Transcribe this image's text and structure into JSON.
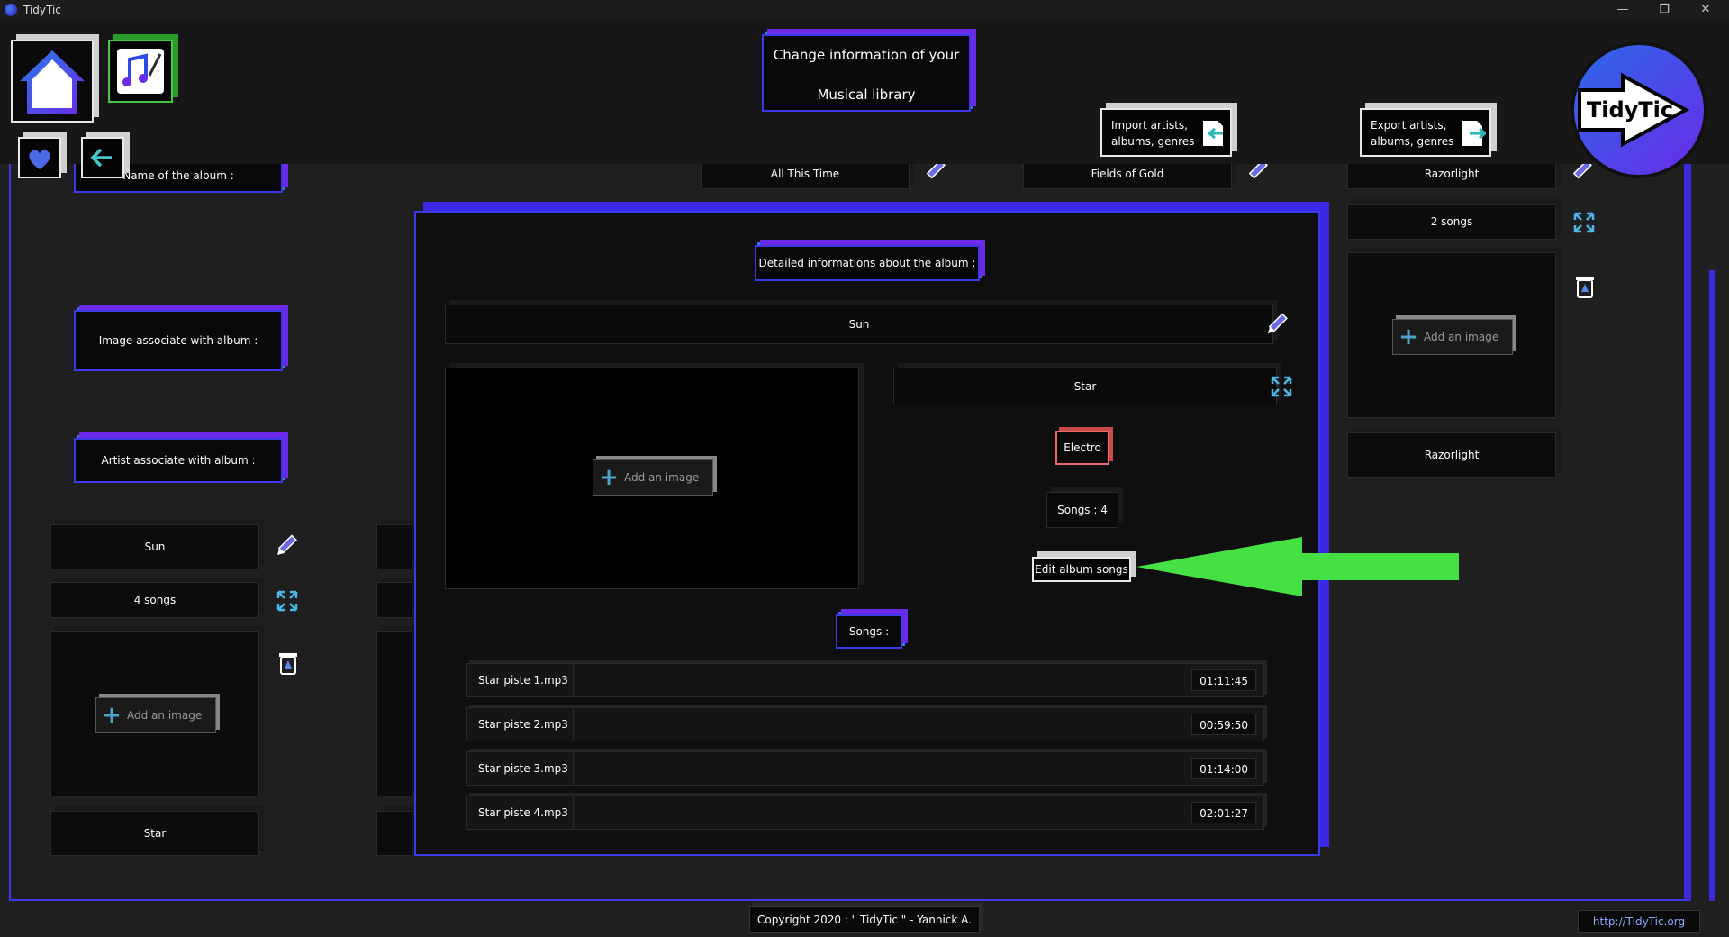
{
  "window": {
    "title": "TidyTic",
    "minimize": "—",
    "restore": "❐",
    "close": "✕"
  },
  "header": {
    "title_line1": "Change information of your",
    "title_line2": "Musical library",
    "import_line1": "Import artists,",
    "import_line2": "albums, genres",
    "export_line1": "Export artists,",
    "export_line2": "albums, genres",
    "logo_text": "TidyTic"
  },
  "left_form": {
    "album_name_label": "Name of the album :",
    "image_label": "Image associate with album :",
    "artist_label": "Artist associate with album :",
    "album_value": "Sun",
    "songs_count": "4 songs",
    "add_image": "Add an image",
    "artist_value": "Star"
  },
  "background_list": {
    "album1": "All This Time",
    "album2": "Fields of Gold",
    "album3": "Razorlight",
    "songs_count": "2 songs",
    "add_image": "Add an image",
    "artist": "Razorlight"
  },
  "modal": {
    "title": "Detailed informations about the album :",
    "album_name": "Sun",
    "artist": "Star",
    "genre": "Electro",
    "songs_count": "Songs : 4",
    "edit_button": "Edit album songs",
    "add_image": "Add an image",
    "songs_header": "Songs :",
    "songs": [
      {
        "name": "Star piste 1.mp3",
        "duration": "01:11:45"
      },
      {
        "name": "Star piste 2.mp3",
        "duration": "00:59:50"
      },
      {
        "name": "Star piste 3.mp3",
        "duration": "01:14:00"
      },
      {
        "name": "Star piste 4.mp3",
        "duration": "02:01:27"
      }
    ]
  },
  "footer": {
    "copyright": "Copyright 2020 : \" TidyTic \" - Yannick A.",
    "link": "http://TidyTic.org"
  },
  "colors": {
    "accent_blue": "#3a3ae8",
    "accent_violet": "#6a2ae8",
    "genre_red": "#e86a6a",
    "arrow_green": "#44e044"
  }
}
